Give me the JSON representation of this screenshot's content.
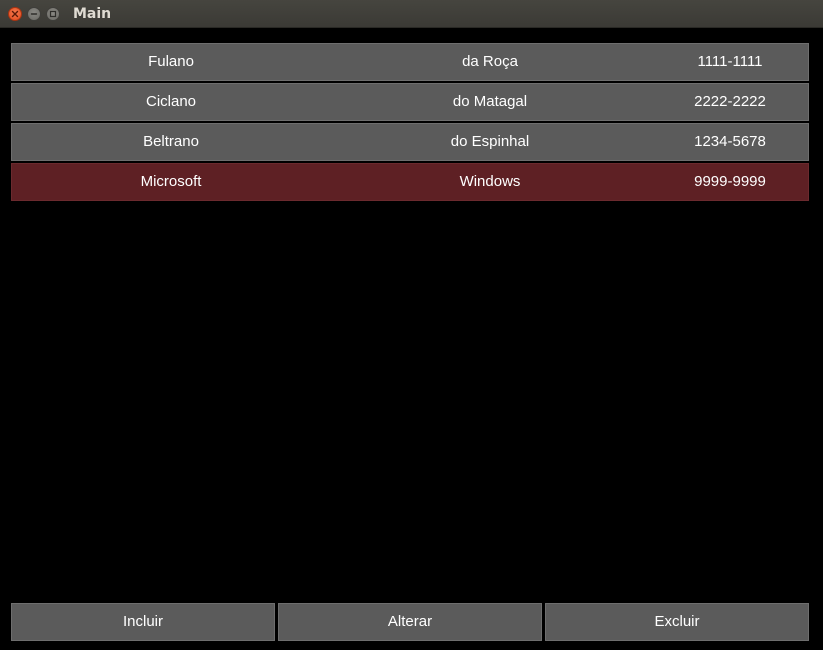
{
  "window": {
    "title": "Main"
  },
  "records": [
    {
      "name": "Fulano",
      "surname": "da Roça",
      "phone": "1111-1111"
    },
    {
      "name": "Ciclano",
      "surname": "do Matagal",
      "phone": "2222-2222"
    },
    {
      "name": "Beltrano",
      "surname": "do Espinhal",
      "phone": "1234-5678"
    },
    {
      "name": "Microsoft",
      "surname": "Windows",
      "phone": "9999-9999"
    }
  ],
  "selected_index": 3,
  "actions": {
    "add_label": "Incluir",
    "edit_label": "Alterar",
    "delete_label": "Excluir"
  },
  "colors": {
    "background": "#000000",
    "row": "#5b5b5b",
    "row_selected": "#5e2024",
    "text": "#ffffff"
  },
  "icons": {
    "close": "close-icon",
    "minimize": "minimize-icon",
    "maximize": "maximize-icon"
  }
}
